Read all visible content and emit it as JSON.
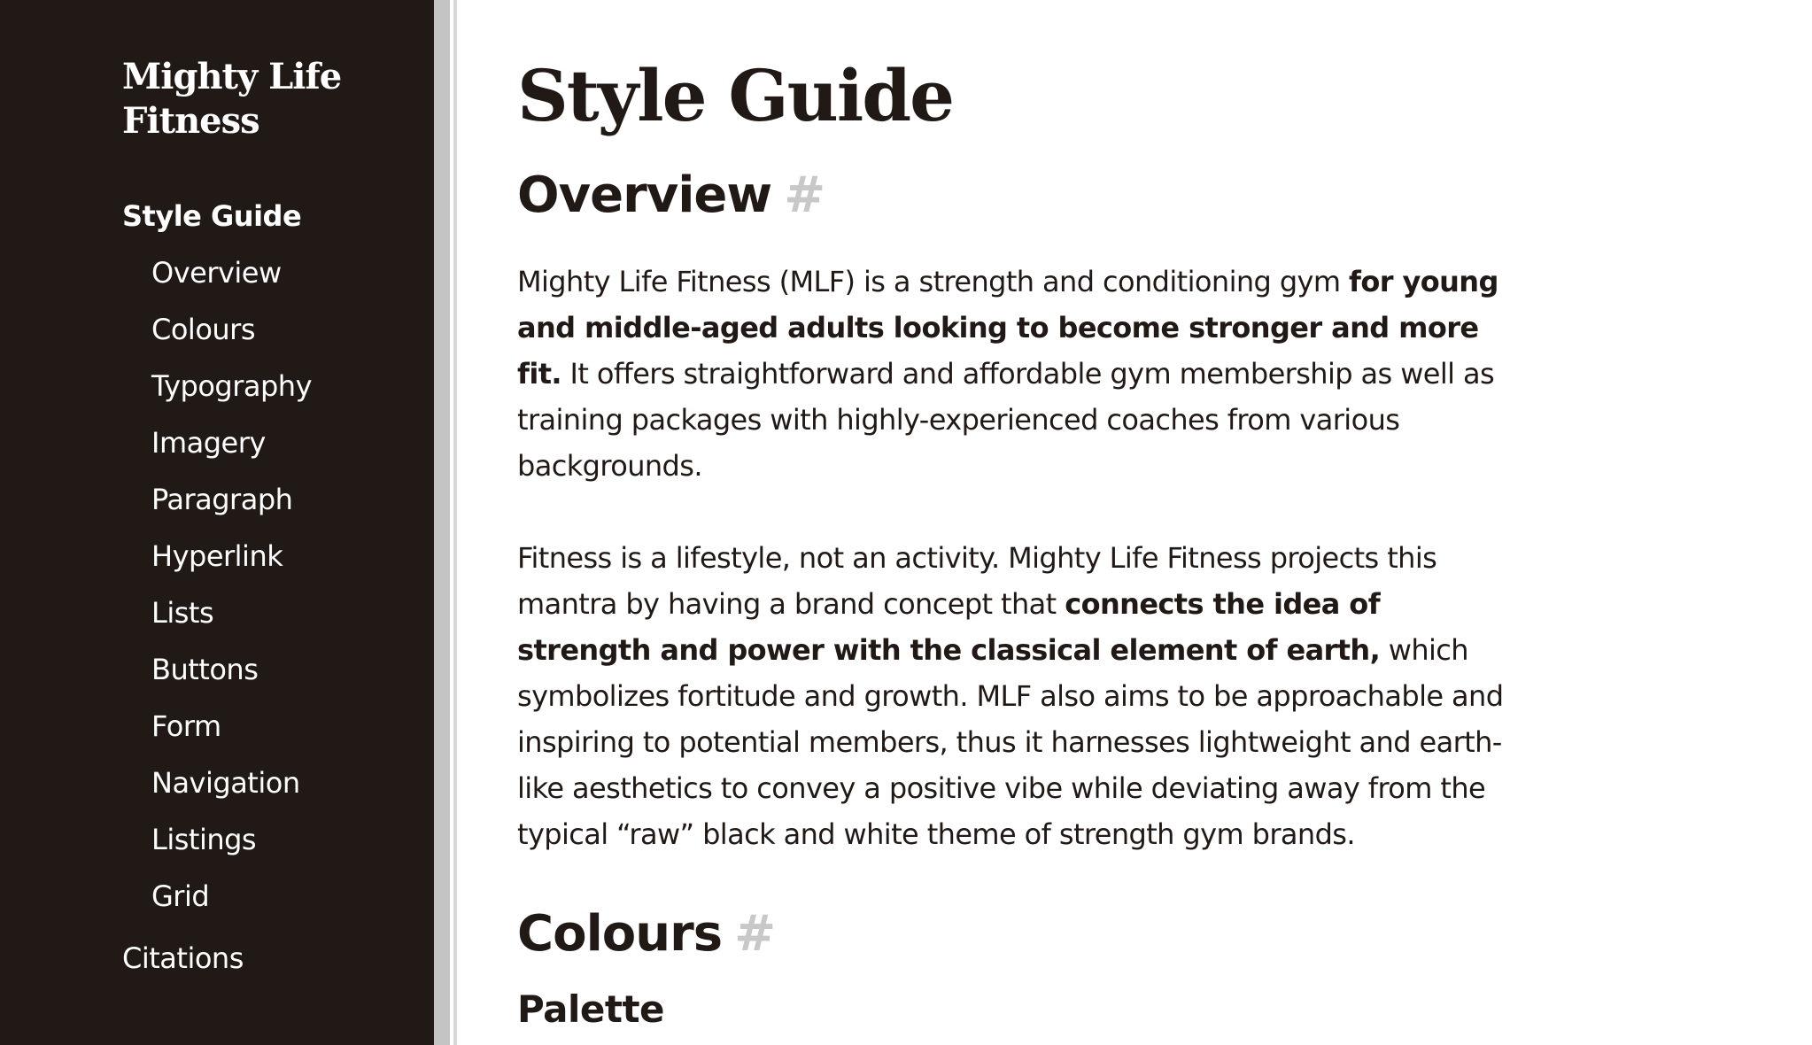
{
  "sidebar": {
    "brand": "Mighty Life Fitness",
    "section": "Style Guide",
    "items": [
      {
        "label": "Overview"
      },
      {
        "label": "Colours"
      },
      {
        "label": "Typography"
      },
      {
        "label": "Imagery"
      },
      {
        "label": "Paragraph"
      },
      {
        "label": "Hyperlink"
      },
      {
        "label": "Lists"
      },
      {
        "label": "Buttons"
      },
      {
        "label": "Form"
      },
      {
        "label": "Navigation"
      },
      {
        "label": "Listings"
      },
      {
        "label": "Grid"
      }
    ],
    "citations": "Citations"
  },
  "main": {
    "title": "Style Guide",
    "overview": {
      "heading": "Overview",
      "anchor": "#",
      "p1": {
        "a": "Mighty Life Fitness (MLF) is a strength and conditioning gym ",
        "b": "for young and middle-aged adults looking to become stronger and more fit.",
        "c": " It offers straightforward and affordable gym membership as well as training packages with highly-experienced coaches from various backgrounds."
      },
      "p2": {
        "a": "Fitness is a lifestyle, not an activity. Mighty Life Fitness projects this mantra by having a brand concept that ",
        "b": "connects the idea of strength and power with the classical element of earth,",
        "c": " which symbolizes fortitude and growth. MLF also aims to be approachable and inspiring to potential members, thus it harnesses lightweight and earth-like aesthetics to convey a positive vibe while deviating away from the typical “raw” black and white theme of strength gym brands."
      }
    },
    "colours": {
      "heading": "Colours",
      "anchor": "#",
      "palette": "Palette"
    }
  },
  "colors": {
    "sidebar_bg": "#211915",
    "text": "#211915",
    "anchor": "#c8c8c8",
    "divider": "#c4c4c4"
  }
}
